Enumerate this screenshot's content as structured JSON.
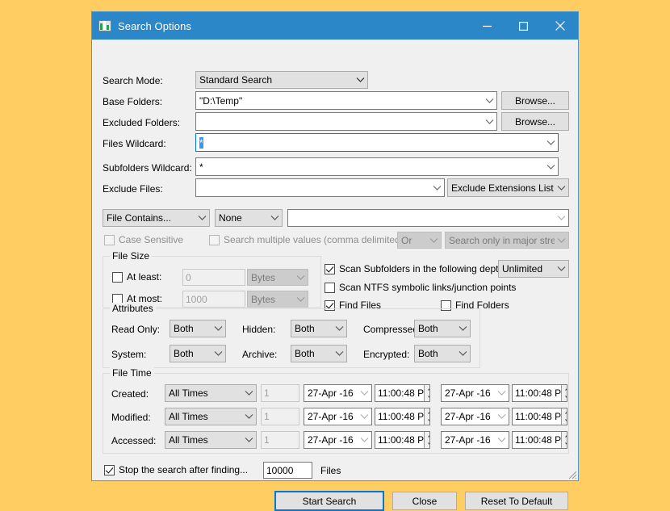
{
  "window": {
    "title": "Search Options",
    "icon": "app-window-icon",
    "minimize": "minimize-icon",
    "maximize": "maximize-icon",
    "close": "close-icon",
    "titlebar_color": "#2b87c8",
    "page_background": "#ffcd61"
  },
  "form": {
    "search_mode": {
      "label": "Search Mode:",
      "value": "Standard Search"
    },
    "base_folders": {
      "label": "Base Folders:",
      "value": "\"D:\\Temp\"",
      "browse": "Browse..."
    },
    "excluded_folders": {
      "label": "Excluded Folders:",
      "value": "",
      "browse": "Browse..."
    },
    "files_wildcard": {
      "label": "Files Wildcard:",
      "value": "*",
      "focused": true
    },
    "subfolders_wildcard": {
      "label": "Subfolders Wildcard:",
      "value": "*"
    },
    "exclude_files": {
      "label": "Exclude Files:",
      "value": "",
      "extensions_button": "Exclude Extensions List"
    },
    "file_contains": {
      "value": "File Contains..."
    },
    "file_contains_mode": {
      "value": "None"
    },
    "file_contains_text": {
      "value": ""
    },
    "case_sensitive": {
      "label": "Case Sensitive",
      "checked": false,
      "enabled": false
    },
    "search_multiple": {
      "label": "Search multiple values (comma delimited)",
      "checked": false,
      "enabled": false
    },
    "logic_operator": {
      "value": "Or",
      "enabled": false
    },
    "stream_scope": {
      "value": "Search only in major strea",
      "enabled": false
    }
  },
  "file_size": {
    "title": "File Size",
    "at_least": {
      "label": "At least:",
      "checked": false,
      "value": "0",
      "unit": "Bytes"
    },
    "at_most": {
      "label": "At most:",
      "checked": false,
      "value": "1000",
      "unit": "Bytes"
    }
  },
  "scan_options": {
    "scan_subfolders": {
      "label": "Scan Subfolders in the following depth:",
      "checked": true
    },
    "depth": {
      "value": "Unlimited"
    },
    "scan_ntfs": {
      "label": "Scan NTFS symbolic links/junction points",
      "checked": false
    },
    "find_files": {
      "label": "Find Files",
      "checked": true
    },
    "find_folders": {
      "label": "Find Folders",
      "checked": false
    }
  },
  "attributes": {
    "title": "Attributes",
    "rows": [
      {
        "label": "Read Only:",
        "value": "Both"
      },
      {
        "label": "Hidden:",
        "value": "Both"
      },
      {
        "label": "Compressed:",
        "value": "Both"
      },
      {
        "label": "System:",
        "value": "Both"
      },
      {
        "label": "Archive:",
        "value": "Both"
      },
      {
        "label": "Encrypted:",
        "value": "Both"
      }
    ]
  },
  "file_time": {
    "title": "File Time",
    "rows": [
      {
        "label": "Created:",
        "mode": "All Times",
        "amount": "1",
        "date_from": "27-Apr -16",
        "time_from": "11:00:48 P",
        "date_to": "27-Apr -16",
        "time_to": "11:00:48 P"
      },
      {
        "label": "Modified:",
        "mode": "All Times",
        "amount": "1",
        "date_from": "27-Apr -16",
        "time_from": "11:00:48 P",
        "date_to": "27-Apr -16",
        "time_to": "11:00:48 P"
      },
      {
        "label": "Accessed:",
        "mode": "All Times",
        "amount": "1",
        "date_from": "27-Apr -16",
        "time_from": "11:00:48 P",
        "date_to": "27-Apr -16",
        "time_to": "11:00:48 P"
      }
    ]
  },
  "footer": {
    "stop_after": {
      "label": "Stop the search after finding...",
      "checked": true
    },
    "limit_value": "10000",
    "files_label": "Files",
    "start_search": "Start Search",
    "close": "Close",
    "reset": "Reset To Default"
  }
}
